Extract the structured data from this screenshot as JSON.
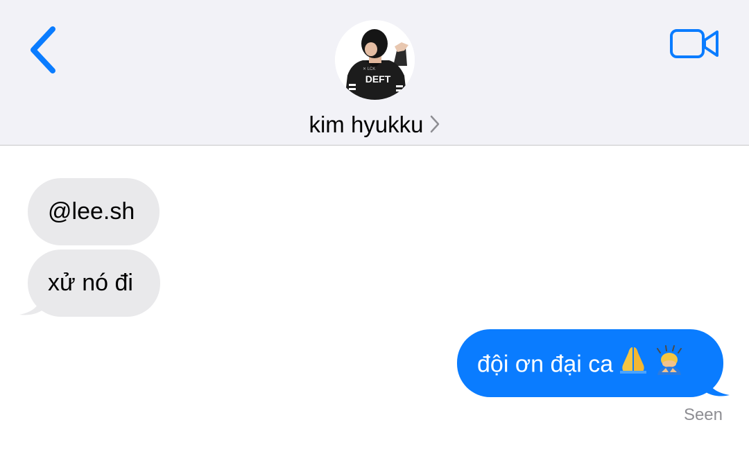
{
  "header": {
    "contact_name": "kim hyukku",
    "avatar_jersey_text": "DEFT",
    "back_icon": "chevron-left-icon",
    "video_icon": "video-camera-icon",
    "name_chevron_icon": "chevron-right-icon"
  },
  "messages": [
    {
      "direction": "incoming",
      "text": "@lee.sh"
    },
    {
      "direction": "incoming",
      "text": "xử nó đi"
    },
    {
      "direction": "outgoing",
      "text": "đội ơn đại ca",
      "emojis": [
        "folded-hands-emoji",
        "bowing-person-emoji"
      ]
    }
  ],
  "status": {
    "seen_label": "Seen"
  },
  "colors": {
    "accent": "#0a7cff",
    "incoming_bubble": "#e9e9eb",
    "header_bg": "#f2f2f7",
    "seen_text": "#8e8e93"
  }
}
